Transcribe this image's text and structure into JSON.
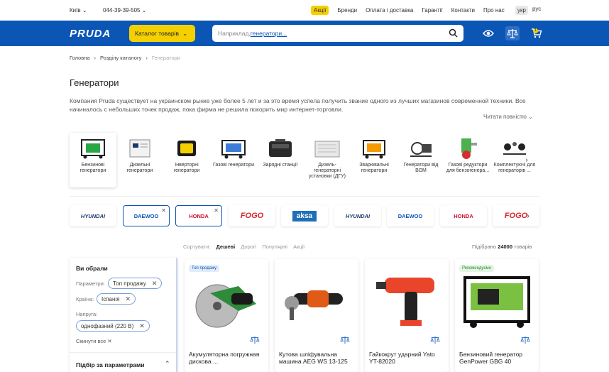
{
  "topbar": {
    "city": "Київ",
    "phone": "044-39-39-505",
    "links": [
      "Акції",
      "Бренди",
      "Оплата і доставка",
      "Гарантії",
      "Контакти",
      "Про нас"
    ],
    "lang_active": "укр",
    "lang_other": "рус"
  },
  "header": {
    "logo": "PRUDA",
    "catalog_label": "Каталог товарів",
    "search_placeholder": "Наприклад, ",
    "search_hint": "генератори...",
    "cart_count": "1"
  },
  "breadcrumbs": [
    "Головна",
    "Розділу каталогу",
    "Генератори"
  ],
  "page": {
    "title": "Генератори",
    "description": "Компания Pruda существует на украинском рынке уже более 5 лет и за это время успела получить звание одного из лучших магазинов современной техники. Все начиналось с небольших точек продаж, пока фирма не решила покорить мир интернет-торговли.",
    "read_more": "Читати повністю"
  },
  "categories": [
    "Бензинові генератори",
    "Дизельні генератори",
    "Інверторні генератори",
    "Газові генератори",
    "Зарядні станції",
    "Дизель-генераторні установки (ДГУ)",
    "Зварювальні генератори",
    "Генератори від ВОМ",
    "Газові редуктори для бензогенера...",
    "Комплектуючі для генераторів ..."
  ],
  "brands": [
    {
      "name": "HYUNDAI",
      "color": "#1b3a6b",
      "selected": false
    },
    {
      "name": "DAEWOO",
      "color": "#0b56b5",
      "selected": true
    },
    {
      "name": "HONDA",
      "color": "#c8102e",
      "selected": true
    },
    {
      "name": "FOGO",
      "color": "#d8232a",
      "selected": false
    },
    {
      "name": "aksa",
      "color": "#1f6fb8",
      "selected": false
    },
    {
      "name": "HYUNDAI",
      "color": "#1b3a6b",
      "selected": false
    },
    {
      "name": "DAEWOO",
      "color": "#0b56b5",
      "selected": false
    },
    {
      "name": "HONDA",
      "color": "#c8102e",
      "selected": false
    },
    {
      "name": "FOGO",
      "color": "#d8232a",
      "selected": false
    }
  ],
  "sort": {
    "label": "Сортувати:",
    "options": [
      "Дешеві",
      "Дорогі",
      "Популярні",
      "Акції"
    ],
    "active": "Дешеві"
  },
  "count": {
    "prefix": "Підібрано",
    "value": "24000",
    "suffix": "товарів"
  },
  "filter": {
    "title": "Ви обрали",
    "params_label": "Параметри:",
    "params_chip": "Топ продажу",
    "country_label": "Країна:",
    "country_chip": "Іспанія",
    "voltage_label": "Напруга:",
    "voltage_chip": "однофазний (220 В)",
    "reset": "Скинути все",
    "params_section": "Підбір за параметрами"
  },
  "products": [
    {
      "badge": "Топ продажу",
      "badge_bg": "#e3ecfa",
      "badge_color": "#0b56b5",
      "name": "Акумуляторна погружная дискова ..."
    },
    {
      "badge": "",
      "badge_bg": "",
      "badge_color": "",
      "name": "Кутова шліфувальна машина AEG WS 13-125"
    },
    {
      "badge": "",
      "badge_bg": "",
      "badge_color": "",
      "name": "Гайкокрут ударний Yato YT-82020"
    },
    {
      "badge": "Рекомендуємо",
      "badge_bg": "#e3f5e3",
      "badge_color": "#2e8b3a",
      "name": "Бензиновий генератор GenPower GBG 40"
    }
  ]
}
